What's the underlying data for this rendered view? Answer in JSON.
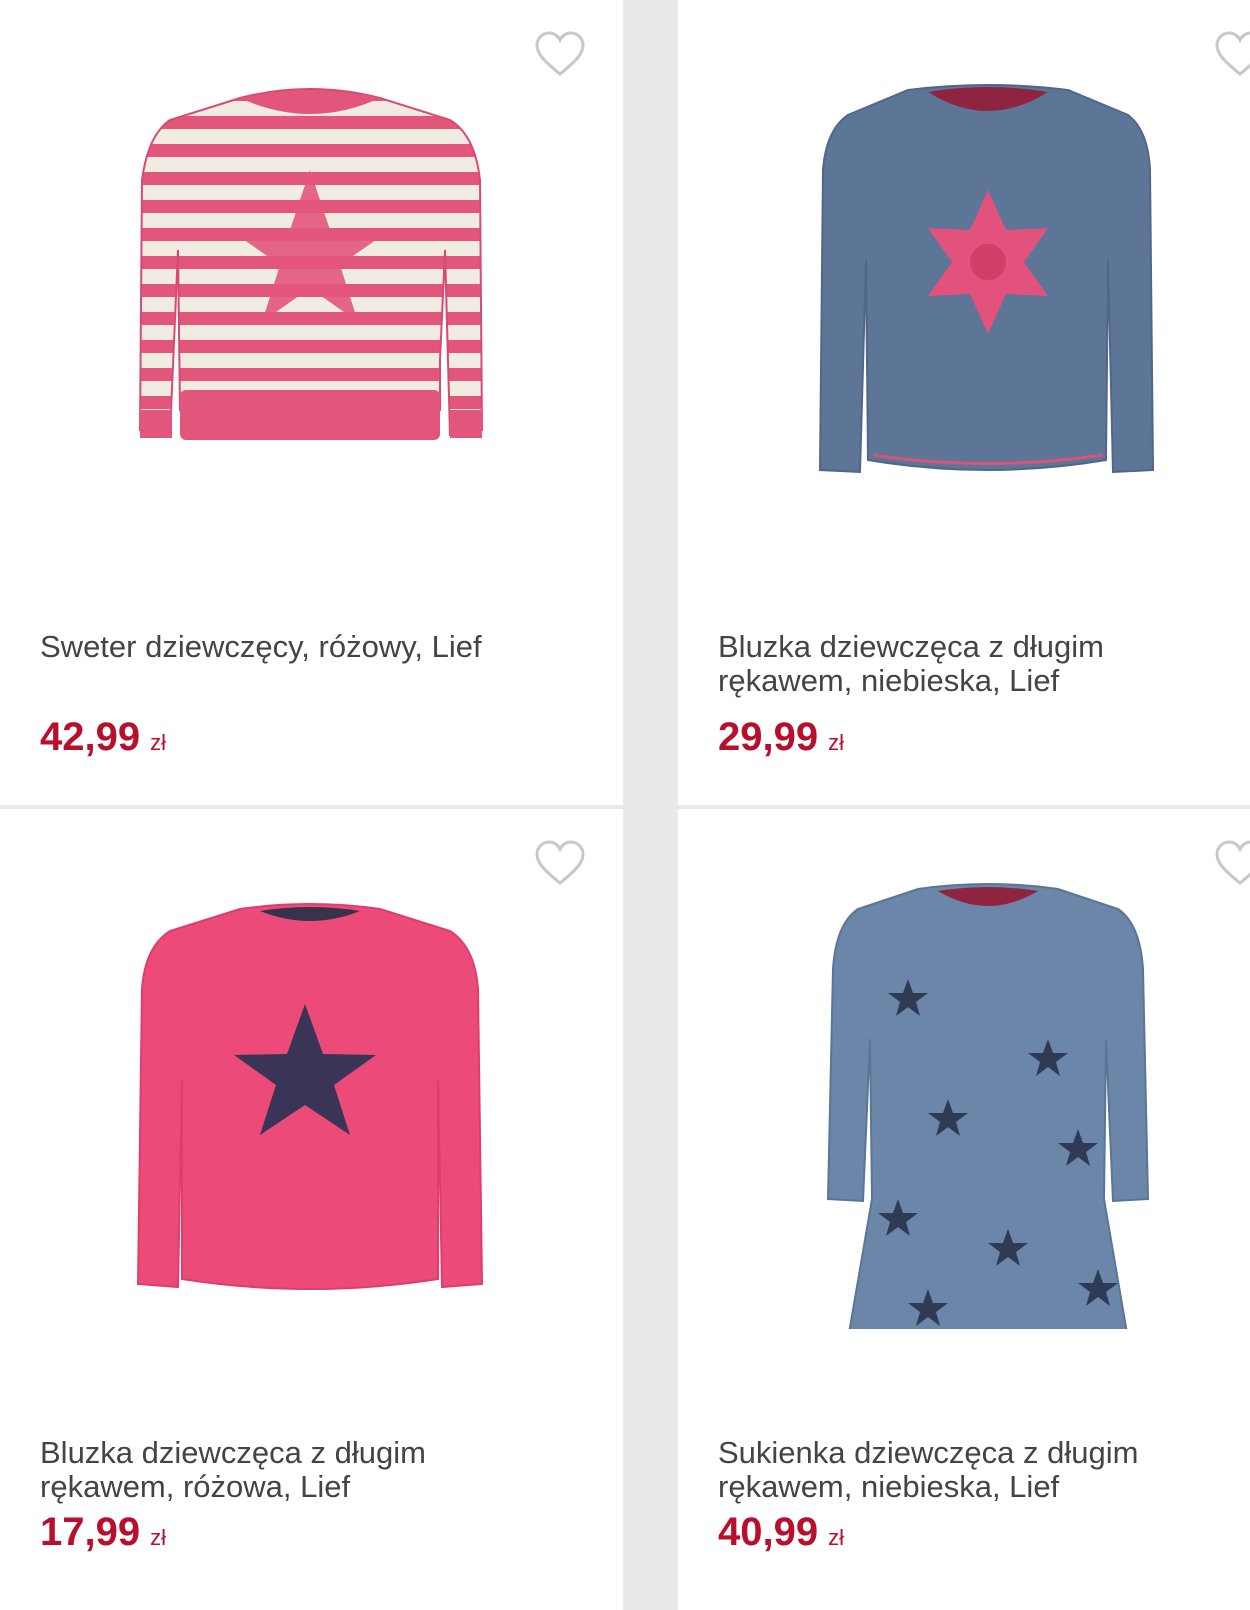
{
  "products": [
    {
      "title": "Sweter dziewczęcy, różowy, Lief",
      "price": "42,99",
      "currency": "zł",
      "image_icon": "pink-striped-sweater-image",
      "favorite_icon": "heart-outline-icon"
    },
    {
      "title": "Bluzka dziewczęca z długim rękawem, niebieska, Lief",
      "price": "29,99",
      "currency": "zł",
      "image_icon": "blue-snowflake-blouse-image",
      "favorite_icon": "heart-outline-icon"
    },
    {
      "title": "Bluzka dziewczęca z długim rękawem, różowa, Lief",
      "price": "17,99",
      "currency": "zł",
      "image_icon": "pink-star-blouse-image",
      "favorite_icon": "heart-outline-icon"
    },
    {
      "title": "Sukienka dziewczęca z długim rękawem, niebieska, Lief",
      "price": "40,99",
      "currency": "zł",
      "image_icon": "blue-star-dress-image",
      "favorite_icon": "heart-outline-icon"
    }
  ],
  "colors": {
    "price": "#b8102c",
    "title": "#444444",
    "background": "#e9e9e9",
    "heart": "#c8c8c8"
  }
}
